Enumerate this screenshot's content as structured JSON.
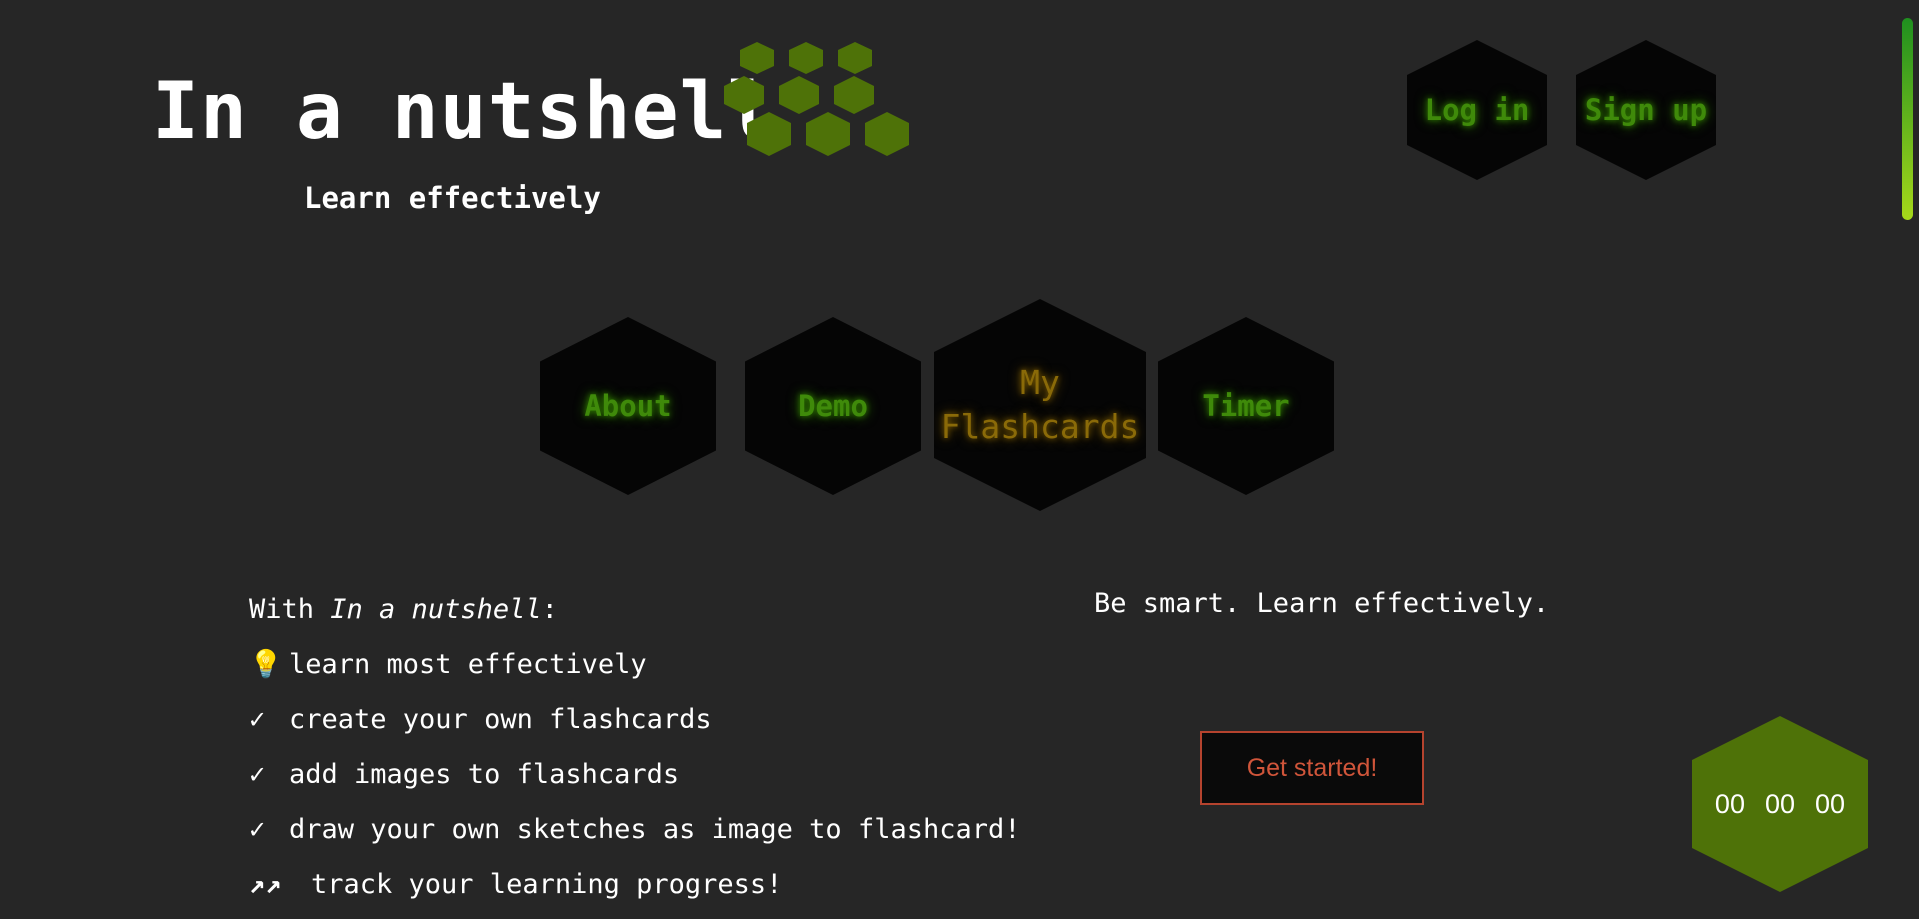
{
  "brand": {
    "title": "In a nutshell",
    "subtitle": "Learn effectively",
    "logo_icon": "honeycomb-icon",
    "logo_color": "#4e7208"
  },
  "auth": {
    "login_label": "Log in",
    "signup_label": "Sign up"
  },
  "nav": {
    "items": [
      {
        "label": "About"
      },
      {
        "label": "Demo"
      },
      {
        "label": "My Flashcards",
        "active": true
      },
      {
        "label": "Timer"
      }
    ]
  },
  "features": {
    "intro_prefix": "With ",
    "intro_app": "In a nutshell",
    "intro_suffix": ":",
    "items": [
      {
        "icon": "lightbulb-icon",
        "glyph": "💡",
        "text": "learn most effectively"
      },
      {
        "icon": "checkmark-icon",
        "glyph": "✓",
        "text": "create your own flashcards"
      },
      {
        "icon": "checkmark-icon",
        "glyph": "✓",
        "text": "add images to flashcards"
      },
      {
        "icon": "checkmark-icon",
        "glyph": "✓",
        "text": "draw your own sketches as image to flashcard!"
      },
      {
        "icon": "trend-up-icon",
        "glyph": "↗↗",
        "text": "track your learning progress!"
      }
    ]
  },
  "tagline": "Be smart. Learn effectively.",
  "cta": {
    "label": "Get started!"
  },
  "timer": {
    "hours": "00",
    "minutes": "00",
    "seconds": "00"
  },
  "colors": {
    "background": "#262626",
    "accent_green": "#4e7208",
    "glow_green": "#3f8a0a",
    "active_gold": "#8a6a08",
    "cta_red": "#d0553a"
  }
}
